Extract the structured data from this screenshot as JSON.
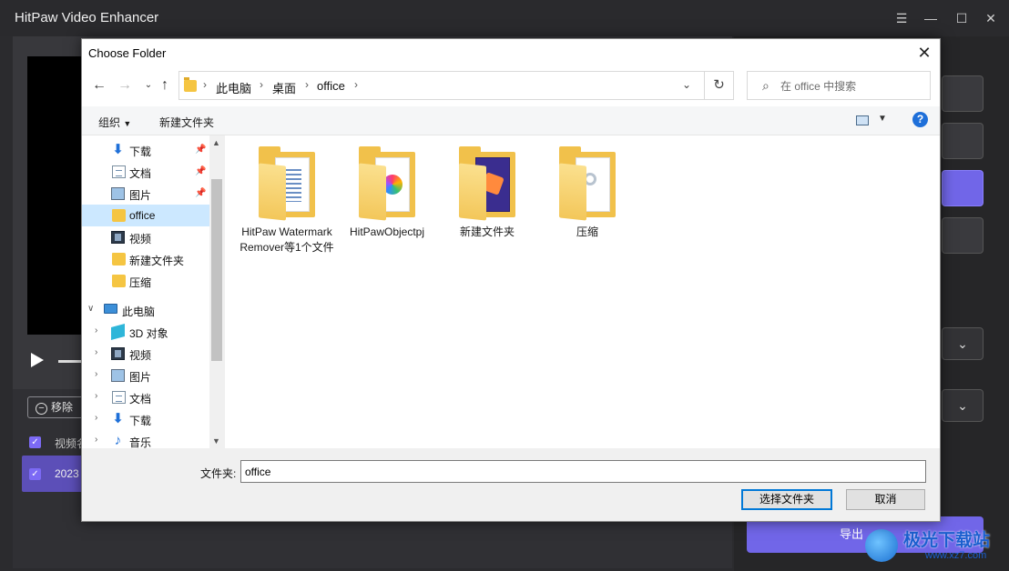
{
  "app": {
    "title": "HitPaw Video Enhancer",
    "remove_button": "移除",
    "list_header": "视频名",
    "row_name": "2023",
    "export_button": "导出",
    "accent_color": "#7166e8",
    "window_controls": [
      "menu-icon",
      "minimize-icon",
      "maximize-icon",
      "close-icon"
    ]
  },
  "watermark": {
    "name": "极光下载站",
    "url": "www.xz7.com"
  },
  "dialog": {
    "title": "Choose Folder",
    "close_icon": "close-icon",
    "address": {
      "crumbs": [
        "此电脑",
        "桌面",
        "office"
      ]
    },
    "search": {
      "placeholder": "在 office 中搜索"
    },
    "toolbar": {
      "organize": "组织",
      "new_folder": "新建文件夹"
    },
    "nav": {
      "items": [
        {
          "label": "下载",
          "icon": "download-icon",
          "pinned": true
        },
        {
          "label": "文档",
          "icon": "document-icon",
          "pinned": true
        },
        {
          "label": "图片",
          "icon": "picture-icon",
          "pinned": true
        },
        {
          "label": "office",
          "icon": "folder-icon",
          "selected": true
        },
        {
          "label": "视频",
          "icon": "video-icon"
        },
        {
          "label": "新建文件夹",
          "icon": "folder-icon"
        },
        {
          "label": "压缩",
          "icon": "folder-icon"
        },
        {
          "label": "此电脑",
          "icon": "computer-icon",
          "expanded": true
        },
        {
          "label": "3D 对象",
          "icon": "3d-objects-icon"
        },
        {
          "label": "视频",
          "icon": "video-icon"
        },
        {
          "label": "图片",
          "icon": "picture-icon"
        },
        {
          "label": "文档",
          "icon": "document-icon"
        },
        {
          "label": "下载",
          "icon": "download-icon"
        },
        {
          "label": "音乐",
          "icon": "music-icon"
        }
      ]
    },
    "files": [
      {
        "name": "HitPaw Watermark Remover等1个文件"
      },
      {
        "name": "HitPawObjectpj"
      },
      {
        "name": "新建文件夹"
      },
      {
        "name": "压缩"
      }
    ],
    "folder_label": "文件夹:",
    "folder_value": "office",
    "select_button": "选择文件夹",
    "cancel_button": "取消"
  }
}
